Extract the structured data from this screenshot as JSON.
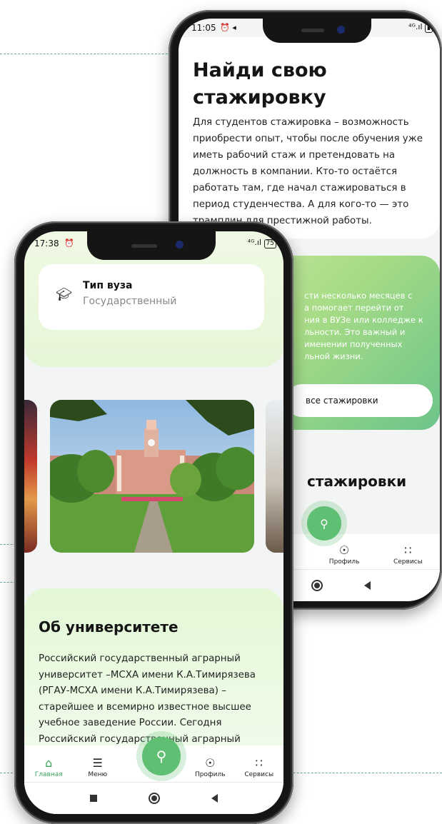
{
  "back_phone": {
    "status": {
      "time": "11:05",
      "icons": "⏰ ◂",
      "right_icons": "⁴ᴳ.ıl",
      "battery": "▮"
    },
    "hero_title_line1": "Найди свою",
    "hero_title_line2": "стажировку",
    "hero_text": "Для студентов стажировка – возможность приобрести опыт, чтобы после обучения уже иметь рабочий стаж и претендовать на должность в компании. Кто-то остаётся работать там, где начал стажироваться в период студенчества. А для кого-то — это трамплин для престижной работы.",
    "green_card_lines": [
      "сти несколько месяцев с",
      "а помогает перейти от",
      "ния в ВУЗе или колледже к",
      "льности. Это важный и",
      "именении полученных",
      "льной жизни."
    ],
    "all_internships_button": "все стажировки",
    "section_title": "стажировки",
    "nav": [
      {
        "icon": "profile-icon",
        "label": "Профиль"
      },
      {
        "icon": "services-icon",
        "label": "Сервисы"
      }
    ]
  },
  "front_phone": {
    "status": {
      "time": "17:38",
      "alarm": "⏰",
      "right_icons": "⁴ᴳ.ıl",
      "battery": "75"
    },
    "uni_type_label": "Тип вуза",
    "uni_type_value": "Государственный",
    "about_title": "Об университете",
    "about_text": "Российский государственный аграрный университет –МСХА имени К.А.Тимирязева (РГАУ-МСХА имени К.А.Тимирязева) – старейшее и всемирно известное высшее учебное заведение России. Сегодня Российский государственный аграрный",
    "nav": [
      {
        "icon": "home-icon",
        "label": "Главная"
      },
      {
        "icon": "menu-icon",
        "label": "Меню"
      },
      {
        "icon": "profile-icon",
        "label": "Профиль"
      },
      {
        "icon": "services-icon",
        "label": "Сервисы"
      }
    ]
  },
  "colors": {
    "accent_green": "#5fbf73",
    "nav_active": "#3aa55a",
    "pale_green": "#e6f6dc"
  }
}
